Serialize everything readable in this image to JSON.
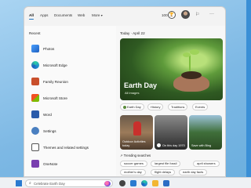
{
  "header": {
    "tabs": [
      {
        "label": "All"
      },
      {
        "label": "Apps"
      },
      {
        "label": "Documents"
      },
      {
        "label": "Web"
      },
      {
        "label": "More"
      }
    ],
    "points": "100"
  },
  "recent": {
    "title": "Recent",
    "items": [
      {
        "label": "Photos",
        "icon": "photos-icon",
        "color": "#2f7fd6"
      },
      {
        "label": "Microsoft Edge",
        "icon": "edge-icon",
        "color": "#1f8fcf"
      },
      {
        "label": "Family Reunion",
        "icon": "powerpoint-icon",
        "color": "#c94f2c"
      },
      {
        "label": "Microsoft Store",
        "icon": "store-icon",
        "color": "#2b6cc4"
      },
      {
        "label": "Word",
        "icon": "word-icon",
        "color": "#2b5cab"
      },
      {
        "label": "Settings",
        "icon": "settings-icon",
        "color": "#4a7fc0"
      },
      {
        "label": "Themes and related settings",
        "icon": "themes-icon",
        "color": "#555555"
      },
      {
        "label": "OneNote",
        "icon": "onenote-icon",
        "color": "#7a3fb0"
      }
    ]
  },
  "today": {
    "heading": "Today · April 22",
    "hero_title": "Earth Day",
    "hero_sub": "All images",
    "chips": [
      "Earth Day",
      "History",
      "Traditions",
      "Events"
    ],
    "cards": [
      {
        "label": "Outdoor Activities today"
      },
      {
        "label": "On this day 1970"
      },
      {
        "label": "Save with Bing"
      }
    ],
    "trending_title": "Trending searches",
    "trending": [
      "soccer games",
      "largest file fossil",
      "april showers",
      "mother's day",
      "flight delays",
      "earth day facts"
    ]
  },
  "taskbar": {
    "search_placeholder": "Celebrate Earth Day"
  }
}
